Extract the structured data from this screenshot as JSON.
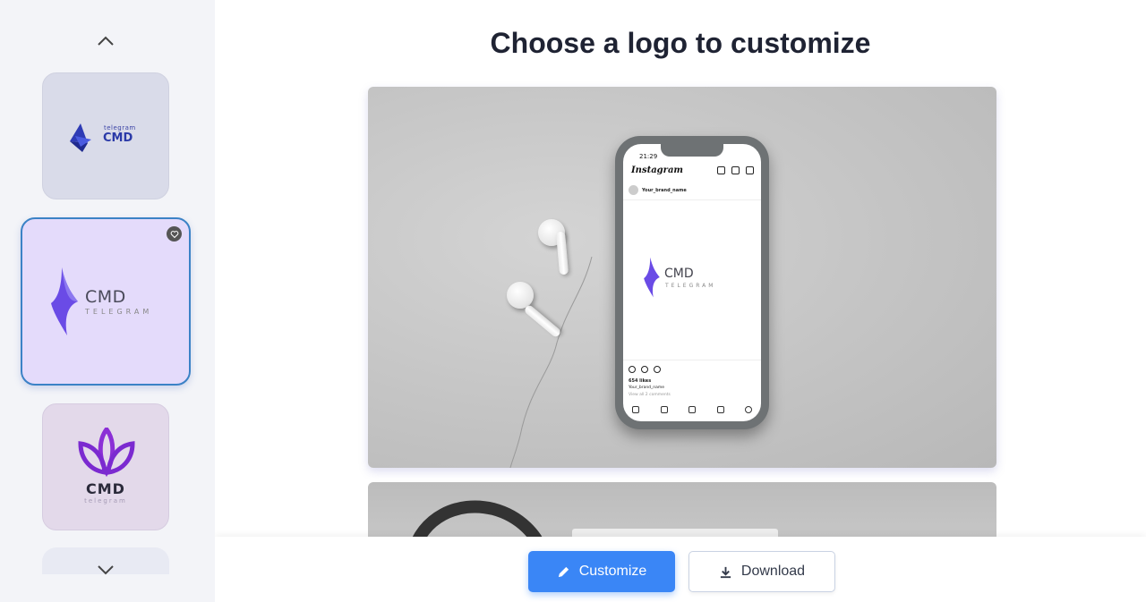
{
  "sidebar": {
    "scroll_up_icon": "chevron-up-icon",
    "scroll_down_icon": "chevron-down-icon",
    "thumbnails": [
      {
        "top_text": "telegram",
        "main_text": "CMD",
        "bg": "#d9dbe9",
        "accent": "#2b3aa8"
      },
      {
        "main_text": "CMD",
        "sub_text": "TELEGRAM",
        "bg": "#e4dbfb",
        "accent": "#6b44e8",
        "selected": true,
        "favorite_icon": "heart-icon"
      },
      {
        "main_text": "CMD",
        "sub_text": "telegram",
        "bg": "#e3d9ea",
        "accent": "#8b2fd6"
      }
    ]
  },
  "main": {
    "title_prefix": "Choose a",
    "title_bold": "logo",
    "title_suffix": "to customize",
    "preview": {
      "status_time": "21:29",
      "app_name": "Instagram",
      "brand_name": "Your_brand_name",
      "logo_text": "CMD",
      "logo_sub": "TELEGRAM",
      "likes": "654 likes",
      "caption": "Your_brand_name",
      "comments": "View all 2 comments"
    }
  },
  "footer": {
    "customize_label": "Customize",
    "customize_icon": "pencil-icon",
    "download_label": "Download",
    "download_icon": "download-icon"
  },
  "colors": {
    "accent": "#3a86f6",
    "sidebar_bg": "#f3f4f8",
    "selected_border": "#3b82c6"
  }
}
